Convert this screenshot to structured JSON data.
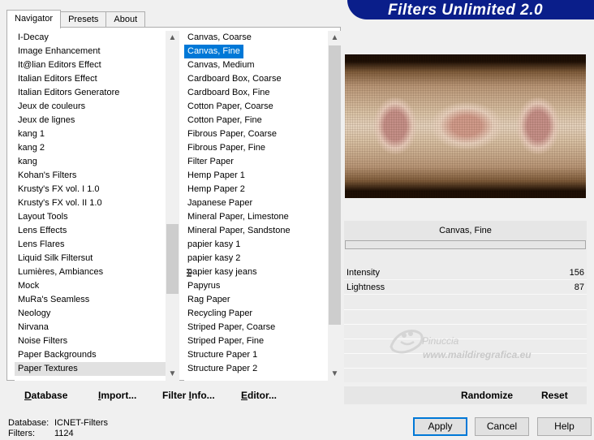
{
  "tabs": [
    "Navigator",
    "Presets",
    "About"
  ],
  "banner_title": "Filters Unlimited 2.0",
  "categories": [
    "I-Decay",
    "Image Enhancement",
    "It@lian Editors Effect",
    "Italian Editors Effect",
    "Italian Editors Generatore",
    "Jeux de couleurs",
    "Jeux de lignes",
    "kang 1",
    "kang 2",
    "kang",
    "Kohan's Filters",
    "Krusty's FX vol. I 1.0",
    "Krusty's FX vol. II 1.0",
    "Layout Tools",
    "Lens Effects",
    "Lens Flares",
    "Liquid Silk Filtersut",
    "Lumières, Ambiances",
    "Mock",
    "MuRa's Seamless",
    "Neology",
    "Nirvana",
    "Noise Filters",
    "Paper Backgrounds",
    "Paper Textures"
  ],
  "categories_selected": "Paper Textures",
  "filters": [
    "Canvas, Coarse",
    "Canvas, Fine",
    "Canvas, Medium",
    "Cardboard Box, Coarse",
    "Cardboard Box, Fine",
    "Cotton Paper, Coarse",
    "Cotton Paper, Fine",
    "Fibrous Paper, Coarse",
    "Fibrous Paper, Fine",
    "Filter Paper",
    "Hemp Paper 1",
    "Hemp Paper 2",
    "Japanese Paper",
    "Mineral Paper, Limestone",
    "Mineral Paper, Sandstone",
    "papier kasy 1",
    "papier kasy 2",
    "papier kasy jeans",
    "Papyrus",
    "Rag Paper",
    "Recycling Paper",
    "Striped Paper, Coarse",
    "Striped Paper, Fine",
    "Structure Paper 1",
    "Structure Paper 2"
  ],
  "filters_selected": "Canvas, Fine",
  "toolbar": {
    "database": {
      "u": "D",
      "rest": "atabase"
    },
    "import": {
      "u": "I",
      "rest": "mport..."
    },
    "filter_info": {
      "pre": "Filter ",
      "u": "I",
      "rest": "nfo..."
    },
    "editor": {
      "u": "E",
      "rest": "ditor..."
    }
  },
  "selected_filter_name": "Canvas, Fine",
  "params": [
    {
      "label": "Intensity",
      "value": "156"
    },
    {
      "label": "Lightness",
      "value": "87"
    }
  ],
  "watermark": {
    "name": "Pinuccia",
    "url": "www.maildiregrafica.eu"
  },
  "right_buttons": {
    "randomize": "Randomize",
    "reset": "Reset"
  },
  "status": {
    "database_label": "Database:",
    "database_value": "ICNET-Filters",
    "filters_label": "Filters:",
    "filters_value": "1124"
  },
  "dialog_buttons": {
    "apply": "Apply",
    "cancel": "Cancel",
    "help": "Help"
  },
  "colors": {
    "accent": "#0078d7",
    "banner": "#0a1e8a"
  }
}
